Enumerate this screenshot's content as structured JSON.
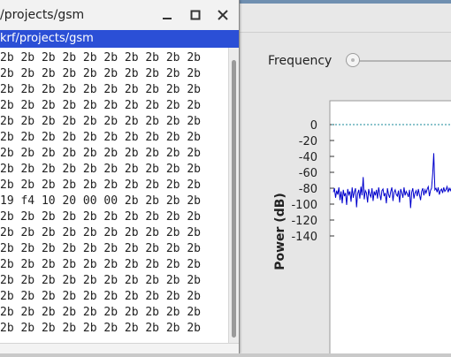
{
  "terminal": {
    "title": "/projects/gsm",
    "tab_title": "krf/projects/gsm",
    "minimize_icon": "minimize-icon",
    "maximize_icon": "maximize-icon",
    "close_icon": "close-icon",
    "hex_rows": [
      "2b 2b 2b 2b 2b 2b 2b 2b 2b 2b",
      "2b 2b 2b 2b 2b 2b 2b 2b 2b 2b",
      "2b 2b 2b 2b 2b 2b 2b 2b 2b 2b",
      "2b 2b 2b 2b 2b 2b 2b 2b 2b 2b",
      "2b 2b 2b 2b 2b 2b 2b 2b 2b 2b",
      "2b 2b 2b 2b 2b 2b 2b 2b 2b 2b",
      "2b 2b 2b 2b 2b 2b 2b 2b 2b 2b",
      "2b 2b 2b 2b 2b 2b 2b 2b 2b 2b",
      "2b 2b 2b 2b 2b 2b 2b 2b 2b 2b",
      "19 f4 10 20 00 00 2b 2b 2b 2b",
      "2b 2b 2b 2b 2b 2b 2b 2b 2b 2b",
      "2b 2b 2b 2b 2b 2b 2b 2b 2b 2b",
      "2b 2b 2b 2b 2b 2b 2b 2b 2b 2b",
      "2b 2b 2b 2b 2b 2b 2b 2b 2b 2b",
      "2b 2b 2b 2b 2b 2b 2b 2b 2b 2b",
      "2b 2b 2b 2b 2b 2b 2b 2b 2b 2b",
      "2b 2b 2b 2b 2b 2b 2b 2b 2b 2b",
      "2b 2b 2b 2b 2b 2b 2b 2b 2b 2b"
    ]
  },
  "spectrum": {
    "frequency_label": "Frequency",
    "slider_value": 0,
    "colors": {
      "trace": "#0000cc",
      "ref_line": "#1a8a9a"
    }
  },
  "chart_data": {
    "type": "line",
    "ylabel": "Power (dB)",
    "xlabel": "",
    "ylim": [
      -140,
      5
    ],
    "yticks": [
      0,
      -20,
      -40,
      -60,
      -80,
      -100,
      -120,
      -140
    ],
    "ytick_labels": [
      "0",
      "-20",
      "-40",
      "-60",
      "-80",
      "-100",
      "-120",
      "-140"
    ],
    "reference_line": 0,
    "grid": false,
    "series": [
      {
        "values": [
          -85,
          -80,
          -92,
          -83,
          -88,
          -79,
          -95,
          -84,
          -99,
          -82,
          -90,
          -86,
          -101,
          -81,
          -88,
          -84,
          -97,
          -79,
          -92,
          -85,
          -80,
          -104,
          -87,
          -82,
          -93,
          -78,
          -89,
          -66,
          -94,
          -83,
          -86,
          -98,
          -81,
          -88,
          -91,
          -80,
          -96,
          -84,
          -89,
          -82,
          -93,
          -79,
          -87,
          -95,
          -83,
          -81,
          -90,
          -86,
          -99,
          -80,
          -88,
          -92,
          -84,
          -79,
          -96,
          -85,
          -82,
          -88,
          -90,
          -83,
          -98,
          -81,
          -86,
          -92,
          -79,
          -89,
          -84,
          -87,
          -91,
          -82,
          -105,
          -85,
          -80,
          -93,
          -86,
          -83,
          -90,
          -81,
          -88,
          -95,
          -84,
          -80,
          -89,
          -82,
          -86,
          -81,
          -78,
          -90,
          -83,
          -80,
          -62,
          -36,
          -82,
          -80,
          -85,
          -79,
          -88,
          -83,
          -81,
          -86,
          -79,
          -84,
          -82,
          -78,
          -85,
          -80,
          -83,
          -79,
          -81,
          -84
        ]
      }
    ]
  }
}
